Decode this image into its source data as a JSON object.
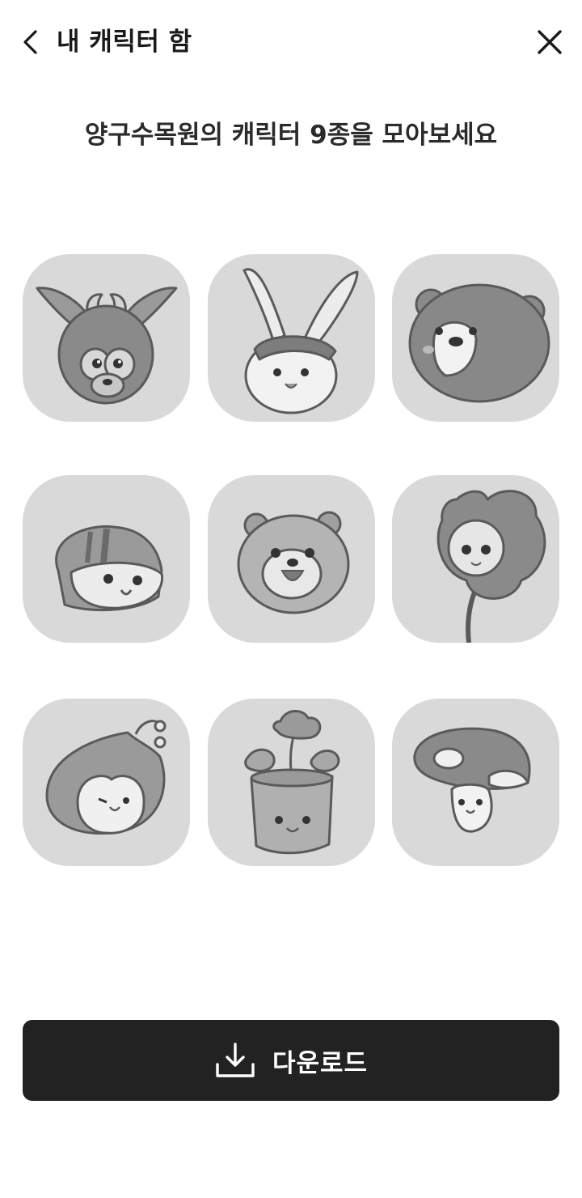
{
  "header": {
    "title": "내 캐릭터 함",
    "back_icon": "chevron-left-icon",
    "close_icon": "close-icon"
  },
  "main": {
    "subtitle": "양구수목원의 캐릭터 9종을 모아보세요",
    "characters": [
      {
        "name": "goat-character"
      },
      {
        "name": "rabbit-character"
      },
      {
        "name": "bear-character"
      },
      {
        "name": "chipmunk-character"
      },
      {
        "name": "otter-character"
      },
      {
        "name": "flower-character"
      },
      {
        "name": "seed-character"
      },
      {
        "name": "tree-stump-character"
      },
      {
        "name": "mushroom-character"
      }
    ]
  },
  "footer": {
    "download_label": "다운로드",
    "download_icon": "download-icon"
  },
  "colors": {
    "background": "#ffffff",
    "tile": "#d9d9d9",
    "button": "#222222",
    "button_text": "#ffffff",
    "text": "#1a1a1a"
  }
}
